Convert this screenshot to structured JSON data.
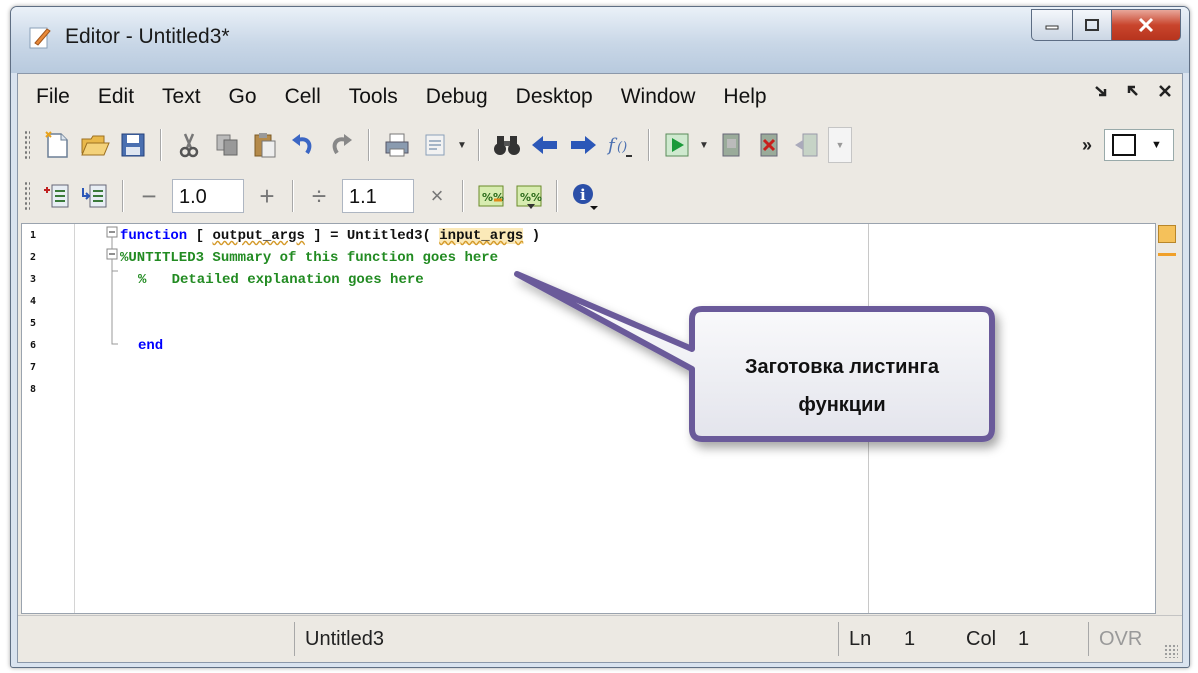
{
  "window": {
    "title": "Editor - Untitled3*"
  },
  "menubar": {
    "items": [
      "File",
      "Edit",
      "Text",
      "Go",
      "Cell",
      "Tools",
      "Debug",
      "Desktop",
      "Window",
      "Help"
    ],
    "right_icons": [
      "undock-arrow-icon",
      "dock-arrow-icon",
      "close-icon"
    ]
  },
  "toolbar2": {
    "decrement_label": "−",
    "value1": "1.0",
    "increment_label": "+",
    "divide_label": "÷",
    "value2": "1.1",
    "multiply_label": "×"
  },
  "editor": {
    "line_numbers": [
      "1",
      "2",
      "3",
      "4",
      "5",
      "6",
      "7",
      "8"
    ],
    "lines": {
      "l1_kw": "function",
      "l1_a": " [ ",
      "l1_out": "output_args",
      "l1_b": " ] = Untitled3( ",
      "l1_in": "input_args",
      "l1_c": " )",
      "l2": "%UNTITLED3 Summary of this function goes here",
      "l3": "%   Detailed explanation goes here",
      "l6": "end"
    }
  },
  "callout": {
    "line1": "Заготовка листинга",
    "line2": "функции"
  },
  "statusbar": {
    "filename": "Untitled3",
    "ln_label": "Ln",
    "ln_value": "1",
    "col_label": "Col",
    "col_value": "1",
    "mode": "OVR"
  },
  "colors": {
    "keyword": "#0000ff",
    "comment": "#228b22",
    "close_button": "#c9452d"
  }
}
